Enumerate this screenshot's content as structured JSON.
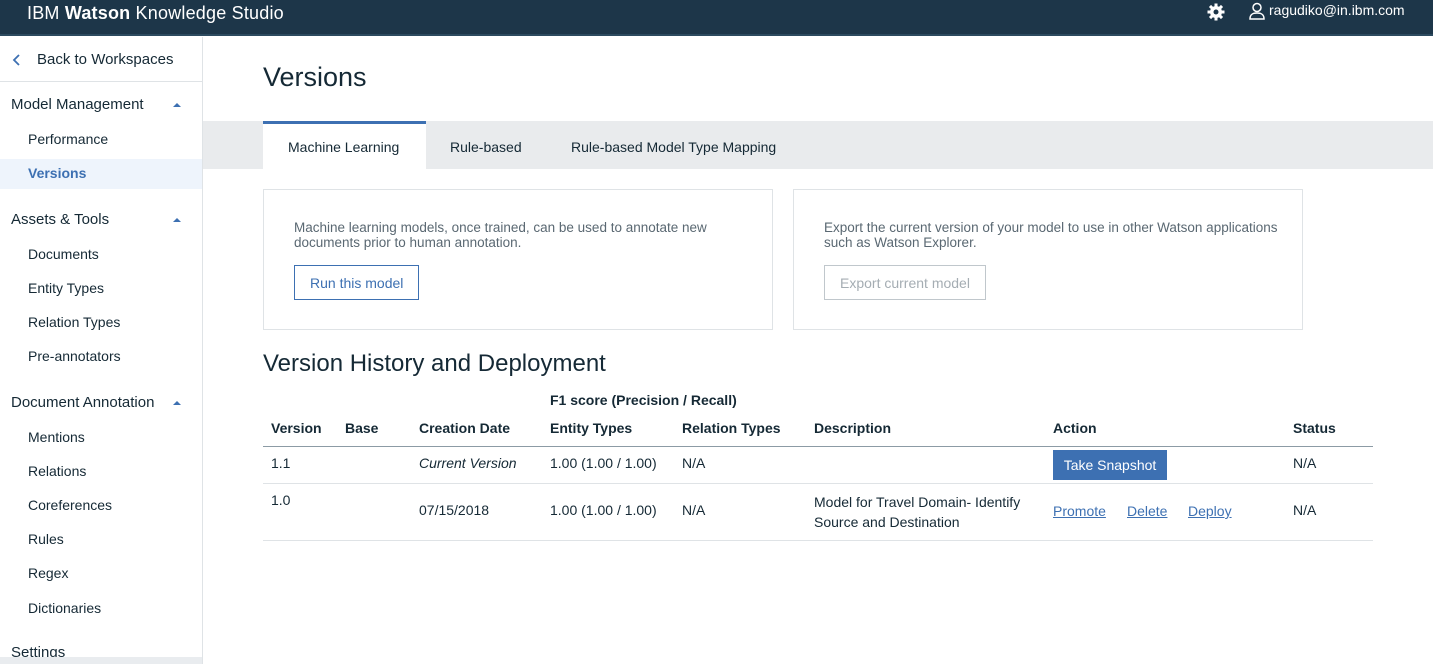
{
  "app": {
    "brand_prefix": "IBM ",
    "brand_bold": "Watson",
    "brand_suffix": " Knowledge Studio",
    "user_email": "ragudiko@in.ibm.com"
  },
  "sidebar": {
    "back_label": "Back to Workspaces",
    "sections": [
      {
        "title": "Model Management",
        "items": [
          "Performance",
          "Versions"
        ]
      },
      {
        "title": "Assets & Tools",
        "items": [
          "Documents",
          "Entity Types",
          "Relation Types",
          "Pre-annotators"
        ]
      },
      {
        "title": "Document Annotation",
        "items": [
          "Mentions",
          "Relations",
          "Coreferences",
          "Rules",
          "Regex",
          "Dictionaries"
        ]
      },
      {
        "title": "Settings"
      }
    ],
    "active_item": "Versions"
  },
  "main": {
    "title": "Versions",
    "tabs": [
      "Machine Learning",
      "Rule-based",
      "Rule-based Model Type Mapping"
    ],
    "active_tab": "Machine Learning",
    "run_card": {
      "text": "Machine learning models, once trained, can be used to annotate new documents prior to human annotation.",
      "button": "Run this model"
    },
    "export_card": {
      "text": "Export the current version of your model to use in other Watson applications such as Watson Explorer.",
      "button": "Export current model"
    },
    "history_title": "Version History and Deployment",
    "table": {
      "group_header": "F1 score (Precision / Recall)",
      "columns": [
        "Version",
        "Base",
        "Creation Date",
        "Entity Types",
        "Relation Types",
        "Description",
        "Action",
        "Status"
      ],
      "rows": [
        {
          "version": "1.1",
          "base": "",
          "date": "Current Version",
          "entity": "1.00 (1.00 / 1.00)",
          "relation": "N/A",
          "description": "",
          "action": "Take Snapshot",
          "status": "N/A"
        },
        {
          "version": "1.0",
          "base": "",
          "date": "07/15/2018",
          "entity": "1.00 (1.00 / 1.00)",
          "relation": "N/A",
          "description": "Model for Travel Domain- Identify Source and Destination",
          "actions": [
            "Promote",
            "Delete",
            "Deploy"
          ],
          "status": "N/A"
        }
      ]
    }
  },
  "icons": {
    "settings": "gear-icon",
    "user": "user-icon",
    "back": "chevron-left-icon",
    "section_toggle": "caret-up-icon"
  },
  "colors": {
    "topbar": "#1d3649",
    "accent": "#3d70b2",
    "text": "#152935"
  }
}
